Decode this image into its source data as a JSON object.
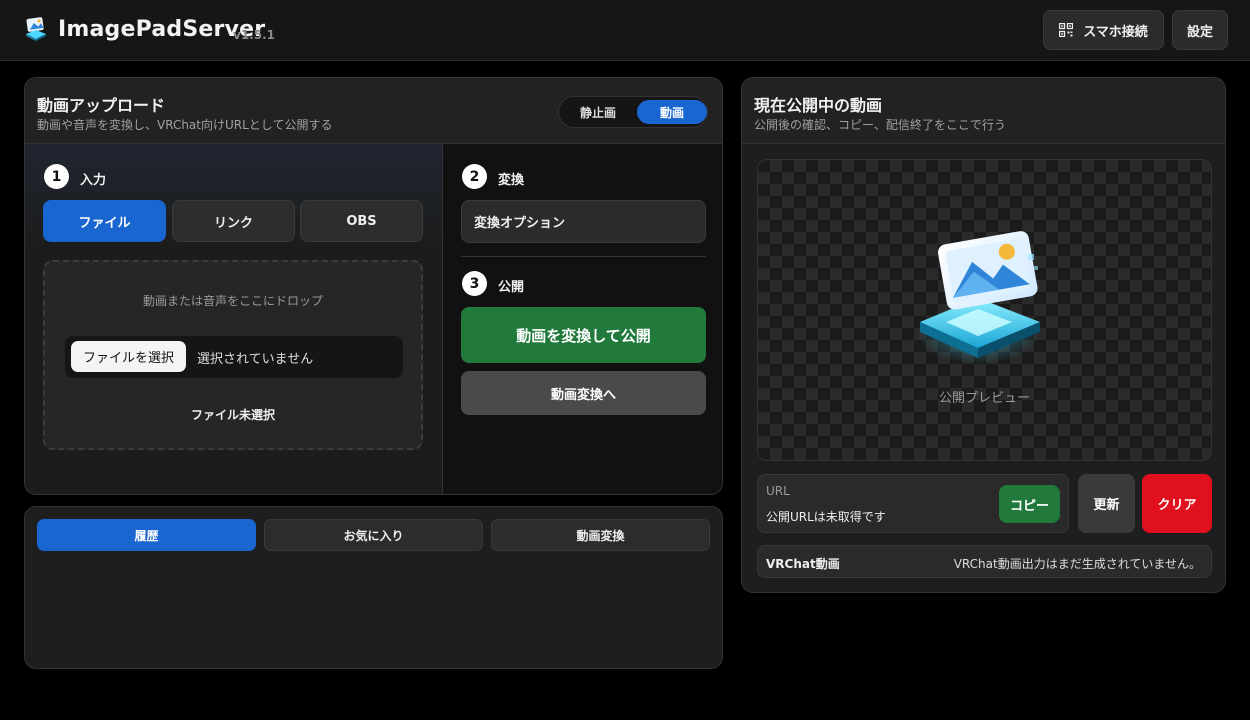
{
  "app": {
    "title": "ImagePadServer",
    "version": "v1.5.1"
  },
  "header": {
    "qr_label": "スマホ接続",
    "settings_label": "設定"
  },
  "upload": {
    "title": "動画アップロード",
    "subtitle": "動画や音声を変換し、VRChat向けURLとして公開する",
    "mode": {
      "still": "静止画",
      "video": "動画",
      "selected": "動画"
    },
    "step1": {
      "num": "1",
      "label": "入力"
    },
    "source_tabs": [
      "ファイル",
      "リンク",
      "OBS"
    ],
    "source_selected": "ファイル",
    "dropzone": {
      "hint": "動画または音声をここにドロップ",
      "choose_label": "ファイルを選択",
      "chosen": "選択されていません",
      "status": "ファイル未選択"
    },
    "step2": {
      "num": "2",
      "label": "変換"
    },
    "convert_options": "変換オプション",
    "step3": {
      "num": "3",
      "label": "公開"
    },
    "publish_button": "動画を変換して公開",
    "goto_convert_button": "動画変換へ"
  },
  "history": {
    "tabs": [
      "履歴",
      "お気に入り",
      "動画変換"
    ],
    "selected": "履歴"
  },
  "current": {
    "title": "現在公開中の動画",
    "subtitle": "公開後の確認、コピー、配信終了をここで行う",
    "preview_label": "公開プレビュー",
    "url_label": "URL",
    "url_value": "公開URLは未取得です",
    "copy_button": "コピー",
    "refresh_button": "更新",
    "clear_button": "クリア",
    "vrchat_label": "VRChat動画",
    "vrchat_status": "VRChat動画出力はまだ生成されていません。"
  },
  "colors": {
    "accent_blue": "#1a66d1",
    "green": "#217a3c",
    "danger": "#e0101e"
  },
  "icons": {
    "logo": "app-logo-icon",
    "qr": "qr-code-icon",
    "preview": "image-pad-illustration"
  }
}
